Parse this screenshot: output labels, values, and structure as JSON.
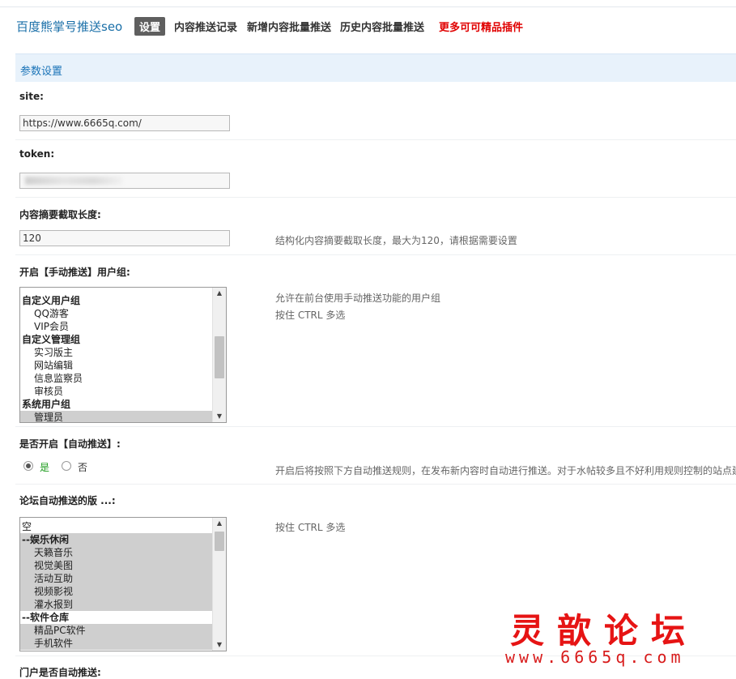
{
  "header": {
    "app_title": "百度熊掌号推送seo",
    "nav": [
      {
        "label": "设置",
        "active": true
      },
      {
        "label": "内容推送记录"
      },
      {
        "label": "新增内容批量推送"
      },
      {
        "label": "历史内容批量推送"
      },
      {
        "label": "更多可可精品插件",
        "color": "#e00000"
      }
    ]
  },
  "section": {
    "title": "参数设置"
  },
  "fields": {
    "site": {
      "label": "site:",
      "value": "https://www.6665q.com/"
    },
    "token": {
      "label": "token:",
      "value": ""
    },
    "summary_length": {
      "label": "内容摘要截取长度:",
      "value": "120",
      "hint": "结构化内容摘要截取长度，最大为120，请根据需要设置"
    },
    "manual_push_groups": {
      "label": "开启【手动推送】用户组:",
      "hint1": "允许在前台使用手动推送功能的用户组",
      "hint2": "按住 CTRL 多选",
      "options": [
        {
          "text": "自定义用户组",
          "group": true
        },
        {
          "text": "QQ游客"
        },
        {
          "text": "VIP会员"
        },
        {
          "text": "自定义管理组",
          "group": true
        },
        {
          "text": "实习版主"
        },
        {
          "text": "网站编辑"
        },
        {
          "text": "信息监察员"
        },
        {
          "text": "审核员"
        },
        {
          "text": "系统用户组",
          "group": true
        },
        {
          "text": "管理员",
          "selected": true
        }
      ]
    },
    "auto_push": {
      "label": "是否开启【自动推送】:",
      "yes": "是",
      "no": "否",
      "selected": "yes",
      "hint": "开启后将按照下方自动推送规则，在发布新内容时自动进行推送。对于水帖较多且不好利用规则控制的站点建"
    },
    "forum_auto_push": {
      "label": "论坛自动推送的版 ...:",
      "hint": "按住 CTRL 多选",
      "options": [
        {
          "text": "空",
          "group": true,
          "plain": true
        },
        {
          "text": "--娱乐休闲",
          "group": true,
          "selected": true
        },
        {
          "text": "天籁音乐",
          "selected": true
        },
        {
          "text": "视觉美图",
          "selected": true
        },
        {
          "text": "活动互助",
          "selected": true
        },
        {
          "text": "视频影视",
          "selected": true
        },
        {
          "text": "灌水报到",
          "selected": true
        },
        {
          "text": "--软件仓库",
          "group": true
        },
        {
          "text": "精品PC软件",
          "selected": true
        },
        {
          "text": "手机软件",
          "selected": true
        }
      ]
    },
    "portal_auto_push": {
      "label": "门户是否自动推送:"
    }
  },
  "watermark": {
    "title": "灵歆论坛",
    "url": "www.6665q.com"
  },
  "colors": {
    "accent": "#1b74b8",
    "promo": "#e00000",
    "section_bg": "#e8f2fb"
  }
}
